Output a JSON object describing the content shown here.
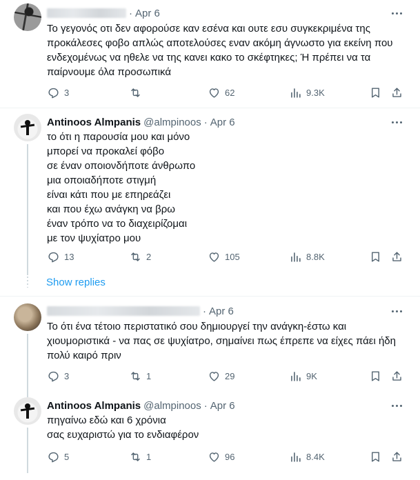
{
  "tweets": [
    {
      "author_name": "",
      "handle": "",
      "date": "Apr 6",
      "text": "Το γεγονός οτι δεν αφορούσε καν εσένα και ουτε εσυ συγκεκριμένα της\nπροκάλεσες φοβο απλώς αποτελούσες εναν ακόμη άγνωστο για εκείνη που\nενδεχομένως να ηθελε να της κανει κακο το σκέφτηκες; Ή πρέπει να τα\nπαίρνουμε όλα προσωπικά",
      "replies": "3",
      "retweets": "",
      "likes": "62",
      "views": "9.3K"
    },
    {
      "author_name": "Antinoos Almpanis",
      "handle": "@almpinoos",
      "date": "Apr 6",
      "text": "το ότι η παρουσία μου και μόνο\nμπορεί να προκαλεί φόβο\nσε έναν οποιονδήποτε άνθρωπο\nμια οποιαδήποτε στιγμή\nείναι κάτι που με επηρεάζει\nκαι που έχω ανάγκη να βρω\nέναν τρόπο να το διαχειρίζομαι\nμε τον ψυχίατρο μου",
      "replies": "13",
      "retweets": "2",
      "likes": "105",
      "views": "8.8K"
    },
    {
      "author_name": "",
      "handle": "",
      "date": "Apr 6",
      "text": "Το ότι ένα τέτοιο περιστατικό σου δημιουργεί την ανάγκη-έστω και\nχιουμοριστικά - να πας σε ψυχίατρο, σημαίνει πως έπρεπε να είχες πάει ήδη\nπολύ καιρό πριν",
      "replies": "3",
      "retweets": "1",
      "likes": "29",
      "views": "9K"
    },
    {
      "author_name": "Antinoos Almpanis",
      "handle": "@almpinoos",
      "date": "Apr 6",
      "text": "πηγαίνω εδώ και 6 χρόνια\nσας ευχαριστώ για το ενδιαφέρον",
      "replies": "5",
      "retweets": "1",
      "likes": "96",
      "views": "8.4K"
    }
  ],
  "show_replies_label": "Show replies",
  "colors": {
    "accent": "#1d9bf0",
    "secondary_text": "#536471",
    "divider": "#eff3f4"
  }
}
